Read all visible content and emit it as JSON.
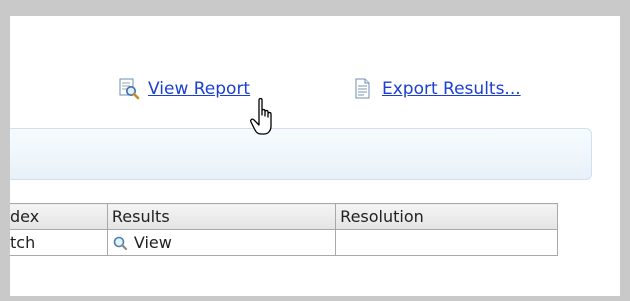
{
  "actions": {
    "view_report": {
      "label": "View Report",
      "icon": "report-magnifier-icon"
    },
    "export_results": {
      "label": "Export Results...",
      "icon": "document-icon"
    }
  },
  "table": {
    "headers": [
      "dex",
      "Results",
      "Resolution"
    ],
    "rows": [
      {
        "index": "tch",
        "results": "View",
        "results_icon": "magnifier-icon",
        "resolution": ""
      }
    ]
  },
  "cursor": {
    "icon": "hand-pointer-icon"
  },
  "colors": {
    "link": "#1a3fd1",
    "panel_border": "#cfe0ef",
    "table_border": "#a9a9a9",
    "background_frame": "#c9c9c9"
  }
}
